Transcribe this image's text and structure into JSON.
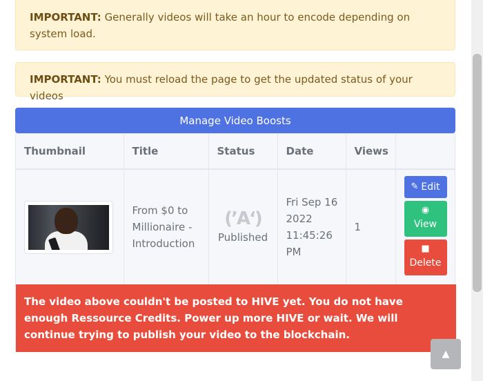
{
  "alerts": [
    {
      "label": "IMPORTANT:",
      "text": "Generally videos will take an hour to encode depending on system load."
    },
    {
      "label": "IMPORTANT:",
      "text": "You must reload the page to get the updated status of your videos"
    }
  ],
  "manage_button": "Manage Video Boosts",
  "table": {
    "headers": [
      "Thumbnail",
      "Title",
      "Status",
      "Date",
      "Views"
    ],
    "row": {
      "title": "From $0 to Millionaire - Introduction",
      "status_icon": "broadcast-icon",
      "status": "Published",
      "date": "Fri Sep 16 2022 11:45:26 PM",
      "views": "1"
    },
    "actions": {
      "edit": "Edit",
      "view": "View",
      "delete": "Delete"
    }
  },
  "error": "The video above couldn't be posted to HIVE yet. You do not have enough Ressource Credits. Power up more HIVE or wait. We will continue trying to publish your video to the blockchain.",
  "colors": {
    "primary": "#4f72e3",
    "success": "#2ec27e",
    "danger": "#e74c3c",
    "warning_bg": "#fff3d6"
  }
}
